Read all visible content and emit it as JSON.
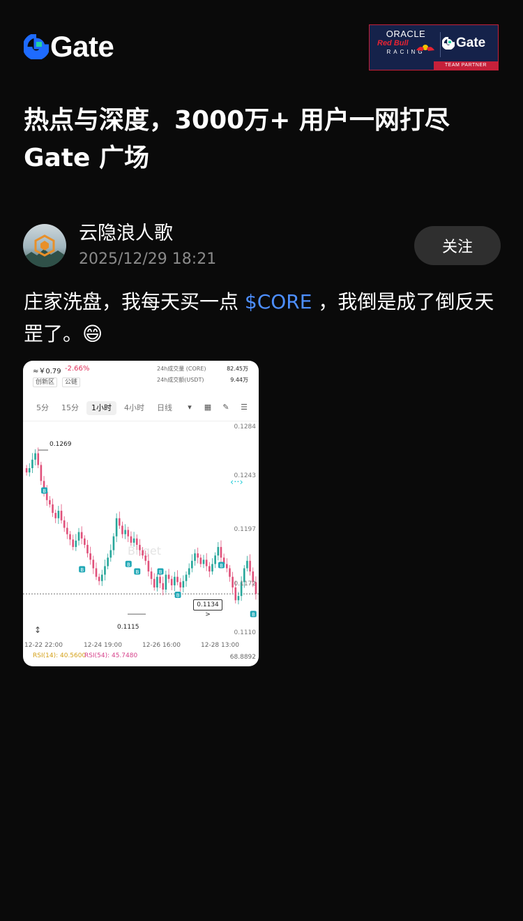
{
  "brand": {
    "name": "Gate",
    "accent_blue": "#1e6bff",
    "accent_green": "#22d3a0"
  },
  "badge": {
    "oracle": "ORACLE",
    "redbull": "Red Bull",
    "racing": "RACING",
    "gate": "Gate",
    "partner": "TEAM PARTNER"
  },
  "headline": {
    "line1": "热点与深度，3000万+ 用户一网打尽",
    "line2": "Gate 广场"
  },
  "author": {
    "name": "云隐浪人歌",
    "time": "2025/12/29 18:21",
    "follow_label": "关注"
  },
  "post": {
    "text_before": "庄家洗盘，我每天买一点 ",
    "tag": "$CORE",
    "text_after": " ，我倒是成了倒反天罡了。",
    "emoji": "😄",
    "tag_color": "#4d8fff"
  },
  "chart_card": {
    "price": "≈￥0.79",
    "change": "-2.66%",
    "chips": [
      "创新区",
      "公链"
    ],
    "stats": [
      {
        "label": "24h成交量 (CORE)",
        "value": "82.45万"
      },
      {
        "label": "24h成交额(USDT)",
        "value": "9.44万"
      }
    ],
    "tabs": [
      "5分",
      "15分",
      "1小时",
      "4小时",
      "日线"
    ],
    "active_tab": "1小时",
    "high_label": "0.1269",
    "low_label": "0.1115",
    "current_price": "0.1134 >",
    "y_ticks": [
      "0.1284",
      "0.1243",
      "0.1197",
      "0.1172",
      "0.1110"
    ],
    "x_ticks": [
      "12-22 22:00",
      "12-24 19:00",
      "12-26 16:00",
      "12-28 13:00"
    ],
    "rsi14": "RSI(14): 40.5600",
    "rsi54": "RSI(54): 45.7480",
    "rsi_right": "68.8892",
    "watermark": "Bitget",
    "up_color": "#26a69a",
    "down_color": "#e0507a"
  },
  "chart_data": {
    "type": "candlestick",
    "x": [
      "12-22 22:00",
      "12-24 19:00",
      "12-26 16:00",
      "12-28 13:00"
    ],
    "y_ticks": [
      0.1284,
      0.1243,
      0.1197,
      0.1172,
      0.111
    ],
    "high": 0.1269,
    "low": 0.1115,
    "last": 0.1134,
    "closes": [
      0.1248,
      0.1252,
      0.126,
      0.1266,
      0.1255,
      0.124,
      0.123,
      0.1222,
      0.1218,
      0.121,
      0.1205,
      0.1212,
      0.1203,
      0.1196,
      0.119,
      0.1185,
      0.1178,
      0.1184,
      0.1192,
      0.1186,
      0.118,
      0.1172,
      0.1166,
      0.1158,
      0.115,
      0.1146,
      0.1152,
      0.116,
      0.1168,
      0.1175,
      0.1188,
      0.1205,
      0.1198,
      0.119,
      0.1194,
      0.1188,
      0.1182,
      0.1186,
      0.118,
      0.1175,
      0.117,
      0.1165,
      0.1155,
      0.1148,
      0.114,
      0.115,
      0.1144,
      0.1138,
      0.1152,
      0.1148,
      0.1142,
      0.115,
      0.1145,
      0.114,
      0.1146,
      0.1152,
      0.1158,
      0.1165,
      0.1172,
      0.1168,
      0.1162,
      0.1166,
      0.116,
      0.1155,
      0.1162,
      0.117,
      0.1178,
      0.1168,
      0.1162,
      0.1158,
      0.115,
      0.114,
      0.1128,
      0.1132,
      0.1145,
      0.1158,
      0.1165,
      0.1155,
      0.1145,
      0.1134
    ]
  }
}
